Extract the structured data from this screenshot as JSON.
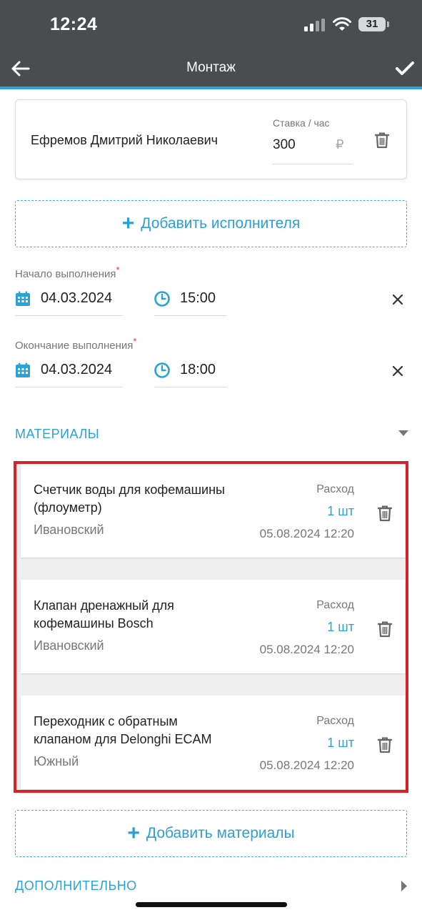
{
  "status_bar": {
    "time": "12:24",
    "battery": "31"
  },
  "nav": {
    "title": "Монтаж"
  },
  "executor": {
    "name": "Ефремов Дмитрий Николаевич",
    "rate_label": "Ставка / час",
    "rate_value": "300",
    "currency": "₽"
  },
  "add_executor": {
    "plus": "+",
    "label": "Добавить исполнителя"
  },
  "start": {
    "label": "Начало выполнения",
    "required": "*",
    "date": "04.03.2024",
    "time": "15:00"
  },
  "end": {
    "label": "Окончание выполнения",
    "required": "*",
    "date": "04.03.2024",
    "time": "18:00"
  },
  "materials_section": {
    "title": "МАТЕРИАЛЫ"
  },
  "materials": [
    {
      "name": "Счетчик воды для кофемашины (флоуметр)",
      "store": "Ивановский",
      "label": "Расход",
      "qty": "1 шт",
      "date": "05.08.2024 12:20"
    },
    {
      "name": "Клапан дренажный для кофемашины Bosch",
      "store": "Ивановский",
      "label": "Расход",
      "qty": "1 шт",
      "date": "05.08.2024 12:20"
    },
    {
      "name": "Переходник с обратным клапаном для Delonghi ECAM",
      "store": "Южный",
      "label": "Расход",
      "qty": "1 шт",
      "date": "05.08.2024 12:20"
    }
  ],
  "add_materials": {
    "plus": "+",
    "label": "Добавить материалы"
  },
  "additional_section": {
    "title": "ДОПОЛНИТЕЛЬНО"
  },
  "colors": {
    "accent": "#2ba3d4",
    "header": "#4a4d50",
    "highlight": "#d7222b"
  },
  "icons": [
    "arrow-left-icon",
    "check-icon",
    "trash-icon",
    "calendar-icon",
    "clock-icon",
    "close-icon",
    "caret-down-icon",
    "caret-right-icon",
    "signal-icon",
    "wifi-icon",
    "battery-icon"
  ]
}
